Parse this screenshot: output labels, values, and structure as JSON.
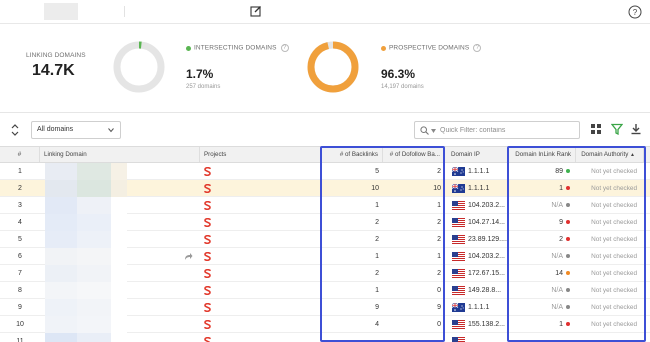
{
  "header": {
    "edit_icon": "edit-icon",
    "help_icon": "help-icon"
  },
  "summary": {
    "linking": {
      "label": "LINKING DOMAINS",
      "value": "14.7K"
    },
    "intersecting": {
      "label": "INTERSECTING DOMAINS",
      "value": "1.7%",
      "sub": "257 domains",
      "color": "#5ab552",
      "fraction": 0.017
    },
    "prospective": {
      "label": "PROSPECTIVE DOMAINS",
      "value": "96.3%",
      "sub": "14,197 domains",
      "color": "#f0a03c",
      "fraction": 0.963
    },
    "help_icon_glyph": "?"
  },
  "filter": {
    "select_value": "All domains",
    "quick_filter_placeholder": "Quick Filter: contains"
  },
  "table": {
    "headers": {
      "num": "#",
      "linking_domain": "Linking Domain",
      "projects": "Projects",
      "backlinks": "# of Backlinks",
      "dofollow": "# of Dofollow Ba...",
      "ip": "Domain IP",
      "inlink_rank": "Domain InLink Rank",
      "authority": "Domain Authority"
    },
    "rows": [
      {
        "num": "1",
        "backlinks": "5",
        "dofollow": "2",
        "flag": "au",
        "ip": "1.1.1.1",
        "rank": "89",
        "rank_color": "#3fb24f",
        "authority": "Not yet checked"
      },
      {
        "num": "2",
        "backlinks": "10",
        "dofollow": "10",
        "flag": "au",
        "ip": "1.1.1.1",
        "rank": "1",
        "rank_color": "#e0302f",
        "authority": "Not yet checked",
        "selected": true
      },
      {
        "num": "3",
        "backlinks": "1",
        "dofollow": "1",
        "flag": "us",
        "ip": "104.203.2...",
        "rank": "N/A",
        "rank_color": "#888888",
        "authority": "Not yet checked"
      },
      {
        "num": "4",
        "backlinks": "2",
        "dofollow": "2",
        "flag": "us",
        "ip": "104.27.14...",
        "rank": "9",
        "rank_color": "#e0302f",
        "authority": "Not yet checked"
      },
      {
        "num": "5",
        "backlinks": "2",
        "dofollow": "2",
        "flag": "us",
        "ip": "23.89.129....",
        "rank": "2",
        "rank_color": "#e0302f",
        "authority": "Not yet checked"
      },
      {
        "num": "6",
        "backlinks": "1",
        "dofollow": "1",
        "flag": "us",
        "ip": "104.203.2...",
        "rank": "N/A",
        "rank_color": "#888888",
        "authority": "Not yet checked"
      },
      {
        "num": "7",
        "backlinks": "2",
        "dofollow": "2",
        "flag": "us",
        "ip": "172.67.15...",
        "rank": "14",
        "rank_color": "#f08a24",
        "authority": "Not yet checked"
      },
      {
        "num": "8",
        "backlinks": "1",
        "dofollow": "0",
        "flag": "us",
        "ip": "149.28.8...",
        "rank": "N/A",
        "rank_color": "#888888",
        "authority": "Not yet checked"
      },
      {
        "num": "9",
        "backlinks": "9",
        "dofollow": "9",
        "flag": "au",
        "ip": "1.1.1.1",
        "rank": "N/A",
        "rank_color": "#888888",
        "authority": "Not yet checked"
      },
      {
        "num": "10",
        "backlinks": "4",
        "dofollow": "0",
        "flag": "us",
        "ip": "155.138.2...",
        "rank": "1",
        "rank_color": "#e0302f",
        "authority": "Not yet checked"
      },
      {
        "num": "11",
        "backlinks": "",
        "dofollow": "",
        "flag": "us",
        "ip": "",
        "rank": "",
        "rank_color": "#888888",
        "authority": ""
      }
    ]
  }
}
